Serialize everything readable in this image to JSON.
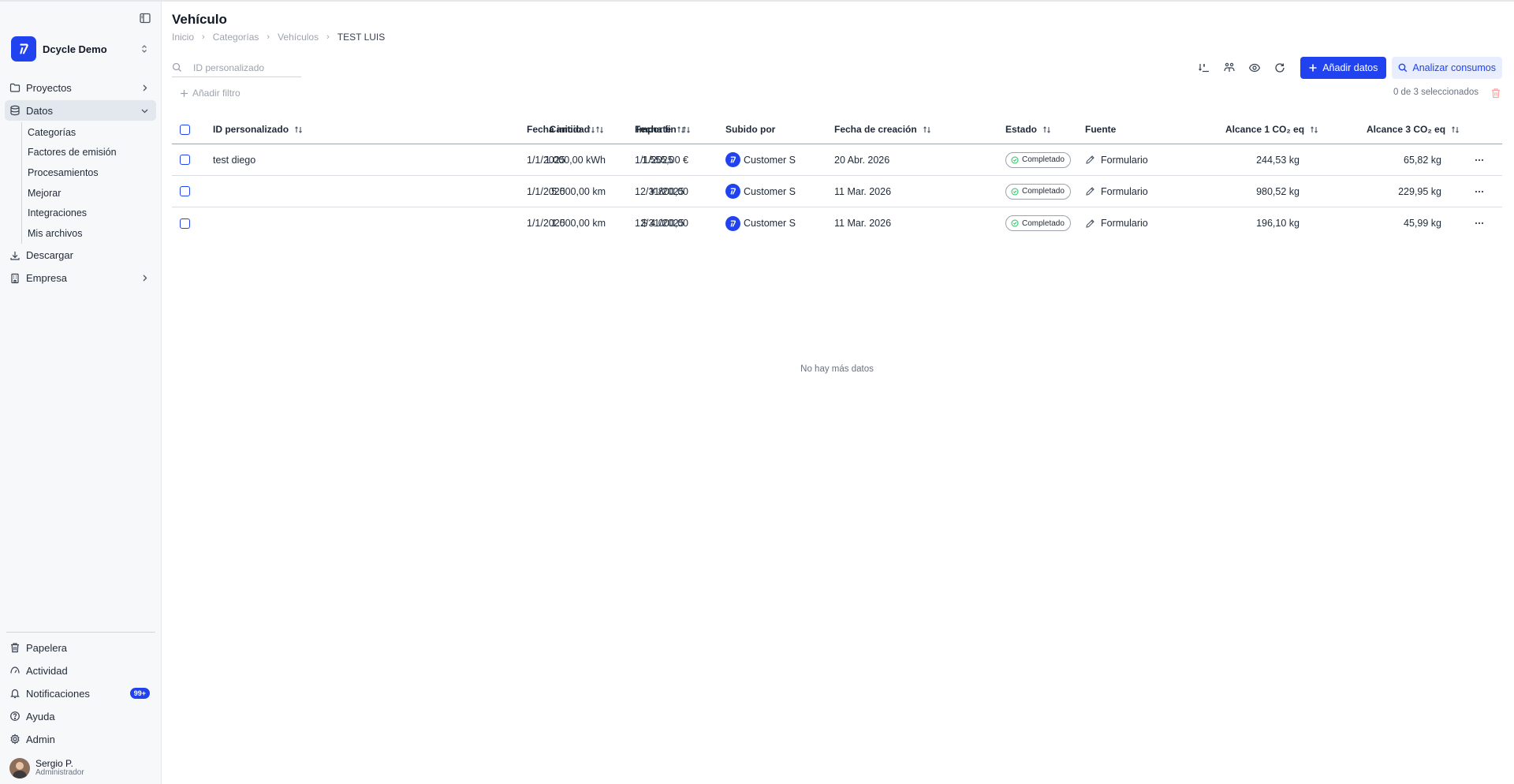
{
  "app": {
    "workspace_name": "Dcycle Demo",
    "brand_color": "#2042ef"
  },
  "sidebar": {
    "items": [
      {
        "label": "Proyectos",
        "icon": "folder-icon"
      },
      {
        "label": "Datos",
        "icon": "database-icon"
      },
      {
        "label": "Descargar",
        "icon": "download-icon"
      },
      {
        "label": "Empresa",
        "icon": "building-icon"
      }
    ],
    "datos_subitems": [
      "Categorías",
      "Factores de emisión",
      "Procesamientos",
      "Mejorar",
      "Integraciones",
      "Mis archivos"
    ],
    "bottom_items": [
      {
        "label": "Papelera",
        "icon": "trash-icon"
      },
      {
        "label": "Actividad",
        "icon": "activity-icon"
      },
      {
        "label": "Notificaciones",
        "icon": "bell-icon",
        "badge": "99+"
      },
      {
        "label": "Ayuda",
        "icon": "help-icon"
      },
      {
        "label": "Admin",
        "icon": "gear-icon"
      }
    ],
    "user": {
      "name": "Sergio P.",
      "role": "Administrador"
    }
  },
  "page": {
    "title": "Vehículo",
    "breadcrumb": [
      "Inicio",
      "Categorías",
      "Vehículos",
      "TEST LUIS"
    ]
  },
  "search": {
    "placeholder": "ID personalizado"
  },
  "toolbar": {
    "add_label": "Añadir datos",
    "analyze_label": "Analizar consumos"
  },
  "filters": {
    "add_filter_label": "Añadir filtro",
    "selection_info": "0 de 3 seleccionados"
  },
  "table": {
    "columns": [
      "ID personalizado",
      "Cantidad",
      "Importe",
      "Fecha inicio",
      "Fecha fin",
      "Subido por",
      "Fecha de creación",
      "Estado",
      "Fuente",
      "Alcance 1 CO₂ eq",
      "Alcance 3 CO₂ eq"
    ],
    "rows": [
      {
        "id": "test diego",
        "cantidad": "1.000,00 kWh",
        "importe": "1.555,00 €",
        "fecha_inicio": "1/1/2025",
        "fecha_fin": "1/1/2025",
        "subido_por": "Customer S",
        "fecha_creacion": "20 Abr. 2026",
        "estado": "Completado",
        "fuente": "Formulario",
        "alcance1": "244,53 kg",
        "alcance3": "65,82 kg"
      },
      {
        "id": "",
        "cantidad": "5.000,00 km",
        "importe": "¥ 800,00",
        "fecha_inicio": "1/1/2025",
        "fecha_fin": "12/31/2025",
        "subido_por": "Customer S",
        "fecha_creacion": "11 Mar. 2026",
        "estado": "Completado",
        "fuente": "Formulario",
        "alcance1": "980,52 kg",
        "alcance3": "229,95 kg"
      },
      {
        "id": "",
        "cantidad": "1.000,00 km",
        "importe": "$ 4.000,00",
        "fecha_inicio": "1/1/2025",
        "fecha_fin": "12/31/2025",
        "subido_por": "Customer S",
        "fecha_creacion": "11 Mar. 2026",
        "estado": "Completado",
        "fuente": "Formulario",
        "alcance1": "196,10 kg",
        "alcance3": "45,99 kg"
      }
    ],
    "empty_message": "No hay más datos"
  }
}
